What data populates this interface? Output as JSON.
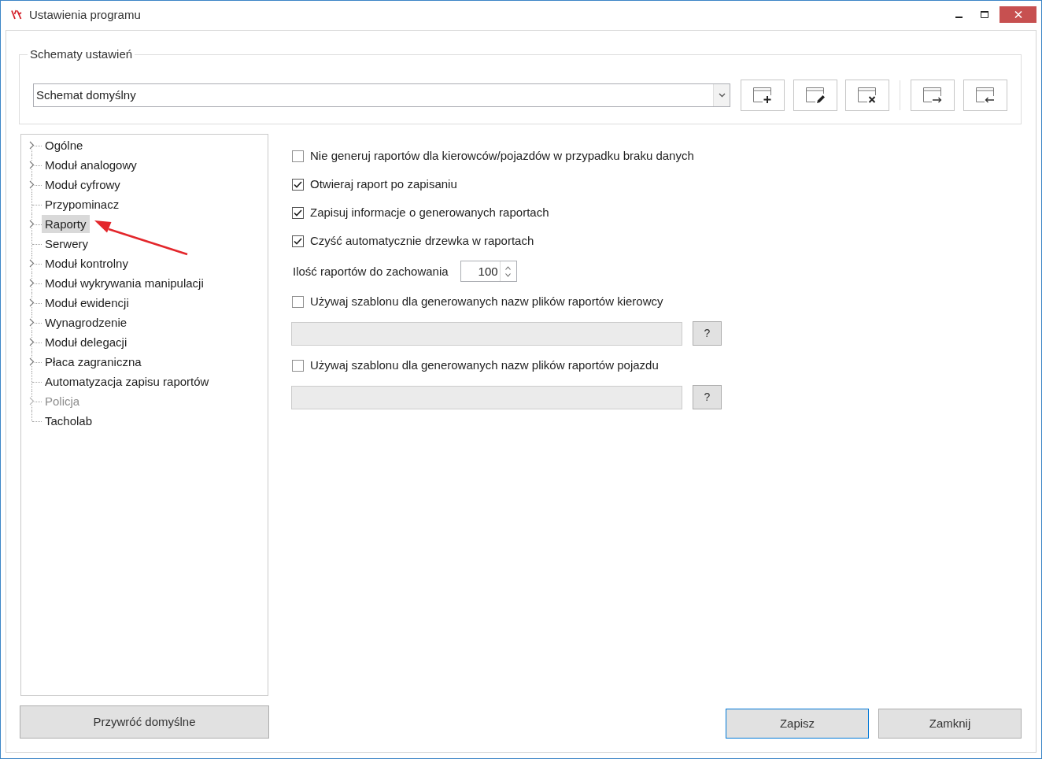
{
  "window": {
    "title": "Ustawienia programu"
  },
  "schemes": {
    "legend": "Schematy ustawień",
    "dropdown": {
      "value": "Schemat domyślny"
    }
  },
  "tree": [
    {
      "label": "Ogólne",
      "kind": "branch",
      "selected": false,
      "disabled": false
    },
    {
      "label": "Moduł analogowy",
      "kind": "branch",
      "selected": false,
      "disabled": false
    },
    {
      "label": "Moduł cyfrowy",
      "kind": "branch",
      "selected": false,
      "disabled": false
    },
    {
      "label": "Przypominacz",
      "kind": "leaf",
      "selected": false,
      "disabled": false
    },
    {
      "label": "Raporty",
      "kind": "branch",
      "selected": true,
      "disabled": false
    },
    {
      "label": "Serwery",
      "kind": "leaf",
      "selected": false,
      "disabled": false
    },
    {
      "label": "Moduł kontrolny",
      "kind": "branch",
      "selected": false,
      "disabled": false
    },
    {
      "label": "Moduł wykrywania manipulacji",
      "kind": "branch",
      "selected": false,
      "disabled": false
    },
    {
      "label": "Moduł ewidencji",
      "kind": "branch",
      "selected": false,
      "disabled": false
    },
    {
      "label": "Wynagrodzenie",
      "kind": "branch",
      "selected": false,
      "disabled": false
    },
    {
      "label": "Moduł delegacji",
      "kind": "branch",
      "selected": false,
      "disabled": false
    },
    {
      "label": "Płaca zagraniczna",
      "kind": "branch",
      "selected": false,
      "disabled": false
    },
    {
      "label": "Automatyzacja zapisu raportów",
      "kind": "leaf",
      "selected": false,
      "disabled": false
    },
    {
      "label": "Policja",
      "kind": "branch",
      "selected": false,
      "disabled": true
    },
    {
      "label": "Tacholab",
      "kind": "leaf",
      "selected": false,
      "disabled": false
    }
  ],
  "options": [
    {
      "kind": "checkbox",
      "label": "Nie generuj raportów dla kierowców/pojazdów w przypadku braku danych",
      "checked": false
    },
    {
      "kind": "checkbox",
      "label": "Otwieraj raport po zapisaniu",
      "checked": true
    },
    {
      "kind": "checkbox",
      "label": "Zapisuj informacje o generowanych raportach",
      "checked": true
    },
    {
      "kind": "checkbox",
      "label": "Czyść automatycznie drzewka w raportach",
      "checked": true
    },
    {
      "kind": "number",
      "label": "Ilość raportów do zachowania",
      "value": "100"
    },
    {
      "kind": "checkbox",
      "label": "Używaj szablonu dla generowanych nazw plików raportów kierowcy",
      "checked": false
    },
    {
      "kind": "template",
      "disabled": true,
      "button": "?"
    },
    {
      "kind": "checkbox",
      "label": "Używaj szablonu dla generowanych nazw plików raportów pojazdu",
      "checked": false
    },
    {
      "kind": "template",
      "disabled": true,
      "button": "?"
    }
  ],
  "buttons": {
    "restore": "Przywróć domyślne",
    "actions": [
      {
        "label": "Zapisz",
        "default": true
      },
      {
        "label": "Zamknij",
        "default": false
      }
    ]
  }
}
